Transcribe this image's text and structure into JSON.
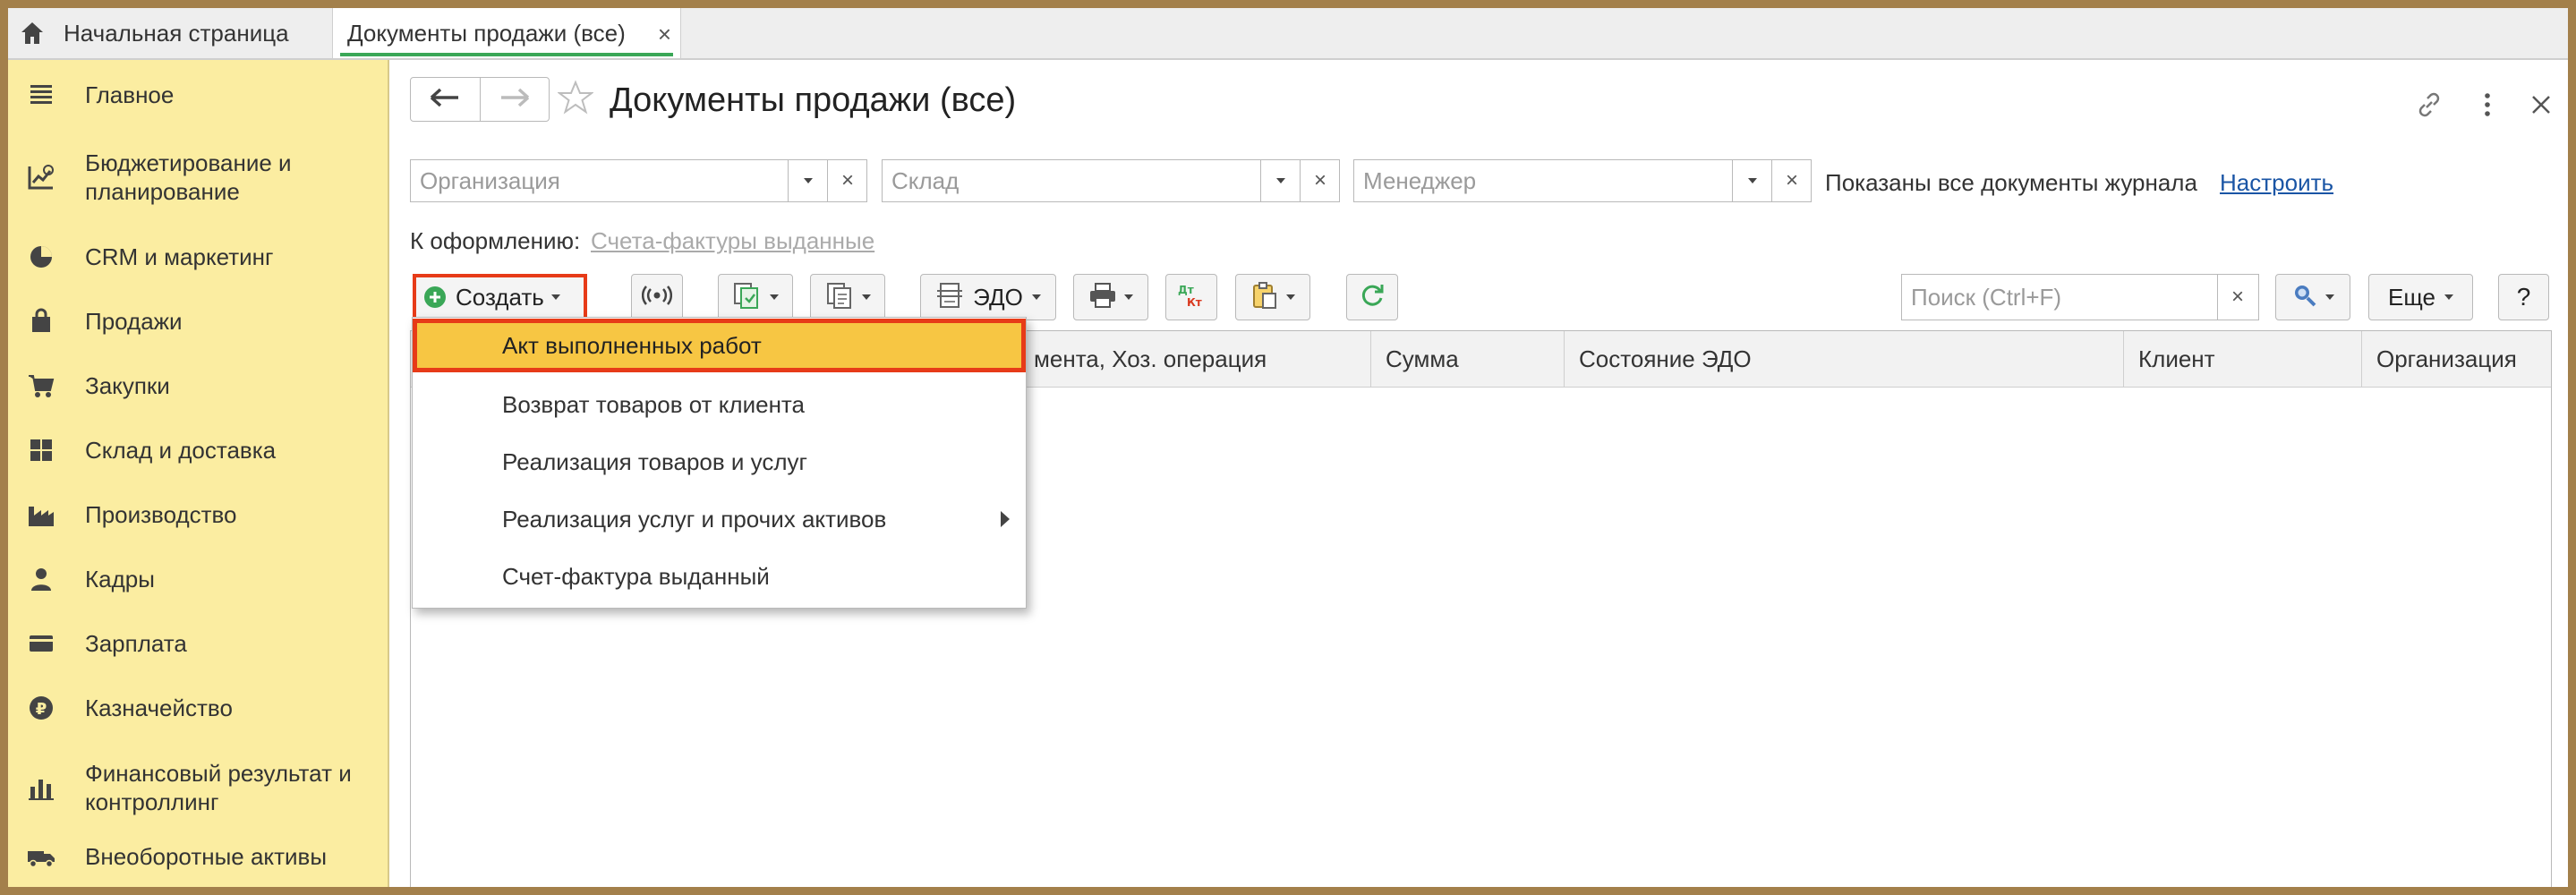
{
  "tabs": {
    "home_label": "Начальная страница",
    "active_label": "Документы продажи (все)",
    "close_glyph": "×"
  },
  "sidebar": {
    "items": [
      {
        "label": "Главное",
        "icon": "menu-lines-icon"
      },
      {
        "label": "Бюджетирование и планирование",
        "icon": "budget-chart-icon"
      },
      {
        "label": "CRM и маркетинг",
        "icon": "pie-chart-icon"
      },
      {
        "label": "Продажи",
        "icon": "shopping-bag-icon"
      },
      {
        "label": "Закупки",
        "icon": "shopping-cart-icon"
      },
      {
        "label": "Склад и доставка",
        "icon": "warehouse-grid-icon"
      },
      {
        "label": "Производство",
        "icon": "factory-icon"
      },
      {
        "label": "Кадры",
        "icon": "person-icon"
      },
      {
        "label": "Зарплата",
        "icon": "wallet-card-icon"
      },
      {
        "label": "Казначейство",
        "icon": "ruble-coin-icon"
      },
      {
        "label": "Финансовый результат и контроллинг",
        "icon": "bar-chart-icon"
      },
      {
        "label": "Внеоборотные активы",
        "icon": "truck-icon"
      }
    ]
  },
  "header": {
    "title": "Документы продажи (все)"
  },
  "filters": {
    "organization_placeholder": "Организация",
    "warehouse_placeholder": "Склад",
    "manager_placeholder": "Менеджер",
    "clear_glyph": "×",
    "status_text": "Показаны все документы журнала",
    "setup_link": "Настроить"
  },
  "todo": {
    "label": "К оформлению:",
    "link": "Счета-фактуры выданные"
  },
  "toolbar": {
    "create_label": "Создать",
    "edo_label": "ЭДО",
    "search_placeholder": "Поиск (Ctrl+F)",
    "more_label": "Еще",
    "help_label": "?"
  },
  "table": {
    "columns": [
      "мента, Хоз. операция",
      "Сумма",
      "Состояние ЭДО",
      "Клиент",
      "Организация"
    ]
  },
  "create_menu": {
    "items": [
      {
        "label": "Акт выполненных работ",
        "selected": true
      },
      {
        "label": "Возврат товаров от клиента",
        "selected": false
      },
      {
        "label": "Реализация товаров и услуг",
        "selected": false
      },
      {
        "label": "Реализация услуг и прочих активов",
        "selected": false,
        "has_submenu": true
      },
      {
        "label": "Счет-фактура выданный",
        "selected": false
      }
    ]
  },
  "colors": {
    "sidebar_bg": "#fbeda1",
    "highlight_border": "#e73b18",
    "selected_item_bg": "#f7c643",
    "link": "#1a55a5",
    "active_tab_underline": "#3aa757",
    "create_icon": "#3aa757"
  }
}
